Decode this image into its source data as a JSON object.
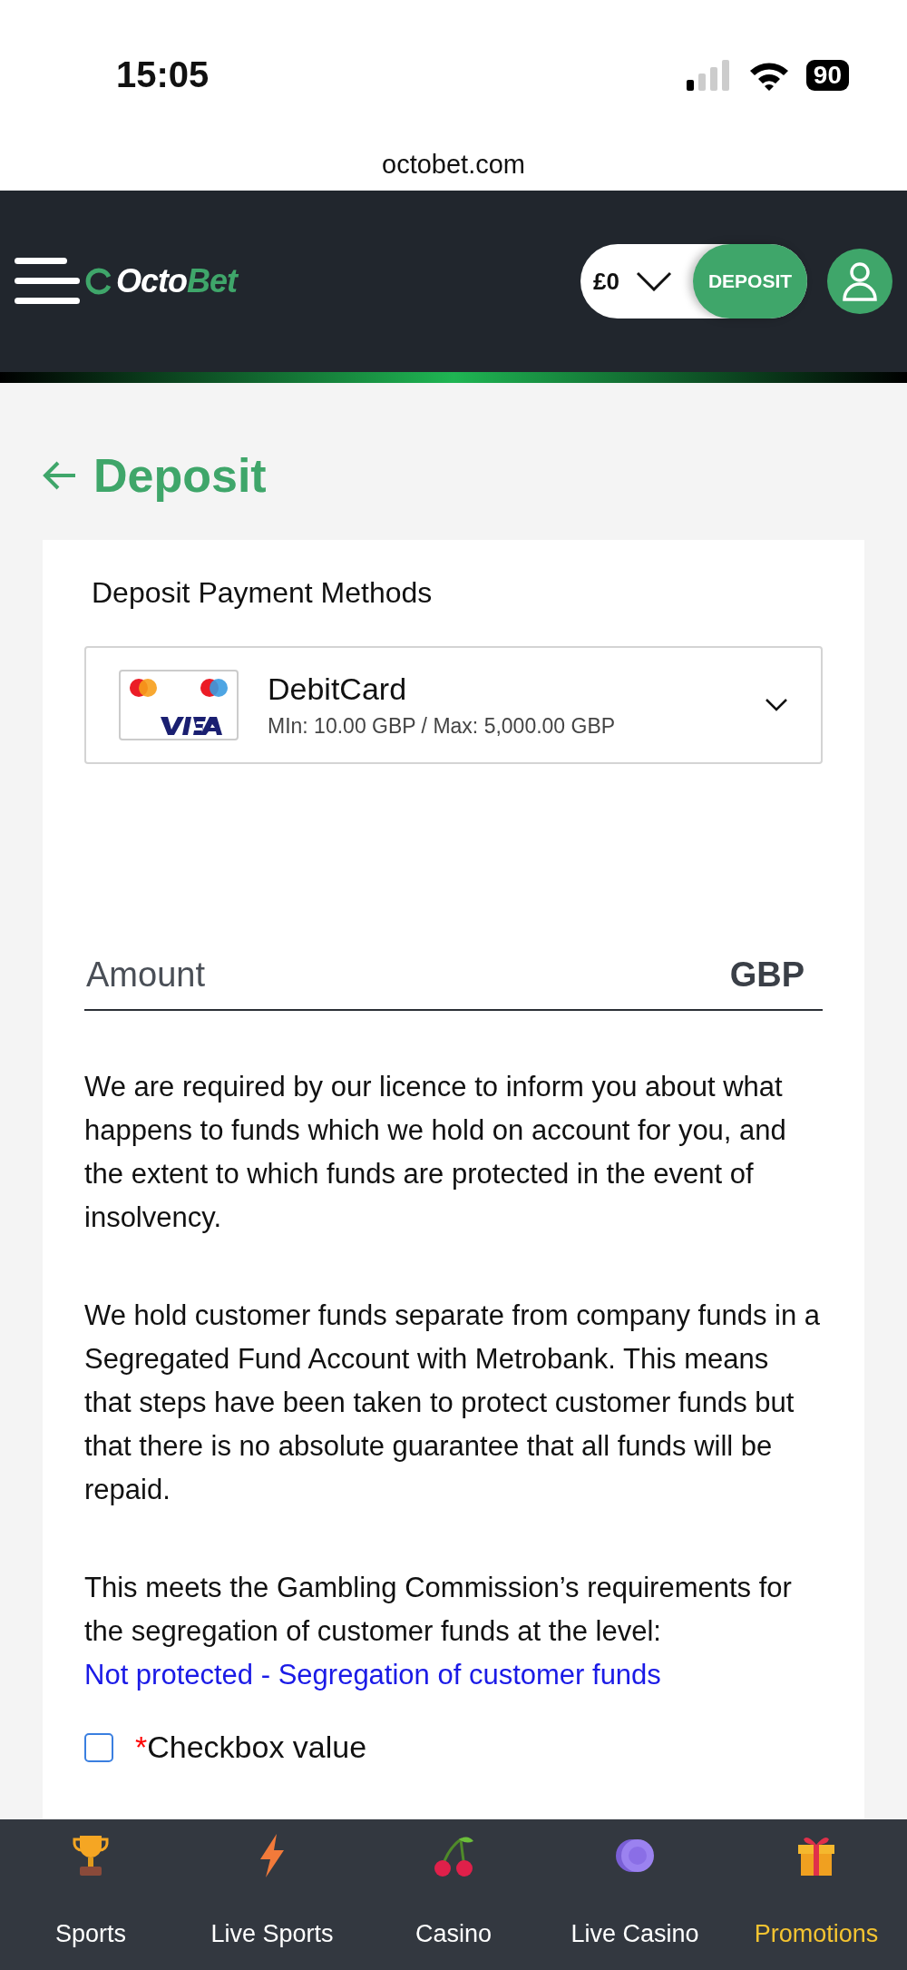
{
  "status_bar": {
    "time": "15:05",
    "battery": "90"
  },
  "browser": {
    "url": "octobet.com"
  },
  "header": {
    "logo_main": "Octo",
    "logo_accent": "Bet",
    "balance": "£0",
    "deposit_button": "DEPOSIT"
  },
  "page_title": "Deposit",
  "card": {
    "heading": "Deposit Payment Methods",
    "payment_method": {
      "name": "DebitCard",
      "limits": "MIn: 10.00 GBP / Max: 5,000.00 GBP"
    },
    "amount": {
      "placeholder": "Amount",
      "currency": "GBP"
    },
    "paragraphs": [
      {
        "text": "We are required by our licence to inform you about what happens to funds which we hold on account for you, and the extent to which funds are protected in the event of insolvency."
      },
      {
        "text": "We hold customer funds separate from company funds in a Segregated Fund Account with Metrobank. This means that steps have been taken to protect customer funds but that there is no absolute guarantee that all funds will be repaid."
      },
      {
        "text": "This meets the Gambling Commission’s requirements for the segregation of customer funds at the level:",
        "link": "Not protected - Segregation of customer funds"
      }
    ],
    "checkbox": {
      "label": "Checkbox value",
      "required_mark": "*",
      "checked": false
    }
  },
  "bottom_nav": [
    {
      "label": "Sports",
      "kind": "trophy",
      "selected": false
    },
    {
      "label": "Live Sports",
      "kind": "bolt",
      "selected": false
    },
    {
      "label": "Casino",
      "kind": "cherries",
      "selected": false
    },
    {
      "label": "Live Casino",
      "kind": "chip",
      "selected": false
    },
    {
      "label": "Promotions",
      "kind": "gift",
      "selected": true
    }
  ]
}
